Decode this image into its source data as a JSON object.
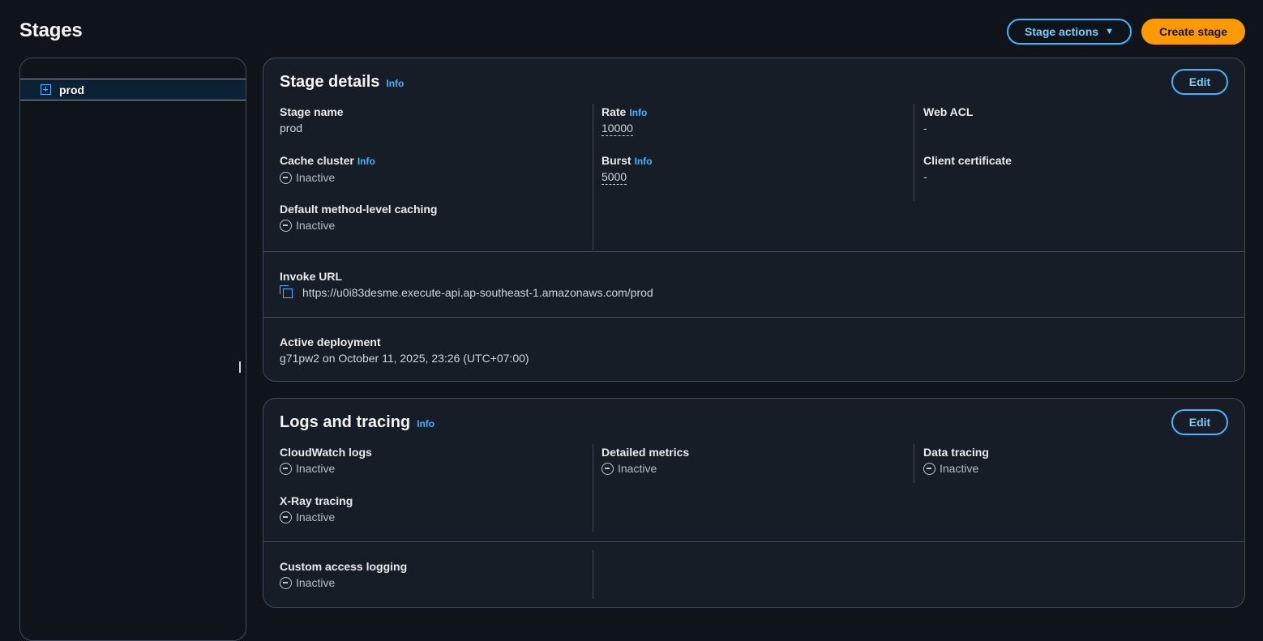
{
  "header": {
    "title": "Stages",
    "stage_actions_label": "Stage actions",
    "create_stage_label": "Create stage"
  },
  "sidebar": {
    "items": [
      {
        "label": "prod"
      }
    ]
  },
  "stage_details": {
    "title": "Stage details",
    "info": "Info",
    "edit": "Edit",
    "stage_name": {
      "label": "Stage name",
      "value": "prod"
    },
    "cache_cluster": {
      "label": "Cache cluster",
      "info": "Info",
      "value": "Inactive"
    },
    "default_caching": {
      "label": "Default method-level caching",
      "value": "Inactive"
    },
    "rate": {
      "label": "Rate",
      "info": "Info",
      "value": "10000"
    },
    "burst": {
      "label": "Burst",
      "info": "Info",
      "value": "5000"
    },
    "web_acl": {
      "label": "Web ACL",
      "value": "-"
    },
    "client_certificate": {
      "label": "Client certificate",
      "value": "-"
    },
    "invoke_url": {
      "label": "Invoke URL",
      "value": "https://u0i83desme.execute-api.ap-southeast-1.amazonaws.com/prod"
    },
    "active_deployment": {
      "label": "Active deployment",
      "value": "g71pw2 on October 11, 2025, 23:26 (UTC+07:00)"
    }
  },
  "logs_tracing": {
    "title": "Logs and tracing",
    "info": "Info",
    "edit": "Edit",
    "cloudwatch_logs": {
      "label": "CloudWatch logs",
      "value": "Inactive"
    },
    "xray_tracing": {
      "label": "X-Ray tracing",
      "value": "Inactive"
    },
    "detailed_metrics": {
      "label": "Detailed metrics",
      "value": "Inactive"
    },
    "data_tracing": {
      "label": "Data tracing",
      "value": "Inactive"
    },
    "custom_access_logging": {
      "label": "Custom access logging",
      "value": "Inactive"
    }
  },
  "icons": {
    "status_inactive": "minus-circle-icon",
    "copy": "copy-icon",
    "expand": "plus-square-icon",
    "caret": "caret-down-icon"
  },
  "colors": {
    "background": "#0f141a",
    "card": "#161d26",
    "accent": "#42b4ff",
    "primary": "#ff9900",
    "border": "#414d5c"
  }
}
